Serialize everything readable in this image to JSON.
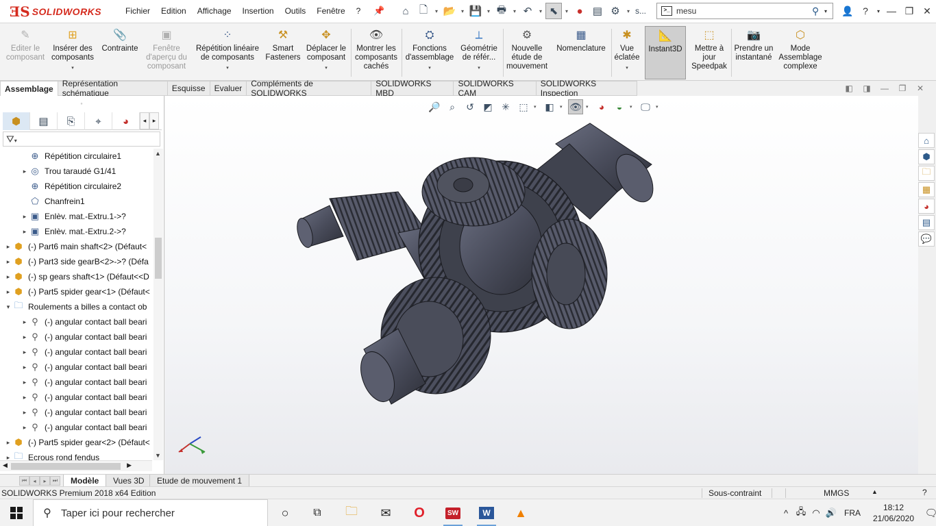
{
  "app": {
    "logo_text": "SOLIDWORKS",
    "menu": [
      "Fichier",
      "Edition",
      "Affichage",
      "Insertion",
      "Outils",
      "Fenêtre",
      "?"
    ],
    "search_value": "mesu",
    "search_extra": "s..."
  },
  "ribbon": [
    {
      "label": "Editer le composant",
      "icon": "edit-component-icon",
      "disabled": true
    },
    {
      "label": "Insérer des composants",
      "icon": "insert-components-icon",
      "arrow": true
    },
    {
      "label": "Contrainte",
      "icon": "mate-icon"
    },
    {
      "label": "Fenêtre d'aperçu du composant",
      "icon": "preview-window-icon",
      "disabled": true
    },
    {
      "label": "Répétition linéaire de composants",
      "icon": "linear-pattern-icon",
      "arrow": true
    },
    {
      "label": "Smart Fasteners",
      "icon": "smart-fasteners-icon"
    },
    {
      "label": "Déplacer le composant",
      "icon": "move-component-icon",
      "arrow": true
    },
    {
      "label": "Montrer les composants cachés",
      "icon": "show-hidden-icon"
    },
    {
      "label": "Fonctions d'assemblage",
      "icon": "assembly-features-icon",
      "arrow": true
    },
    {
      "label": "Géométrie de référ...",
      "icon": "reference-geometry-icon",
      "arrow": true
    },
    {
      "label": "Nouvelle étude de mouvement",
      "icon": "motion-study-icon"
    },
    {
      "label": "Nomenclature",
      "icon": "bom-icon"
    },
    {
      "label": "Vue éclatée",
      "icon": "exploded-view-icon",
      "arrow": true
    },
    {
      "label": "Instant3D",
      "icon": "instant3d-icon",
      "active": true
    },
    {
      "label": "Mettre à jour Speedpak",
      "icon": "speedpak-icon"
    },
    {
      "label": "Prendre un instantané",
      "icon": "snapshot-icon"
    },
    {
      "label": "Mode Assemblage complexe",
      "icon": "large-assembly-icon"
    }
  ],
  "cm_tabs": [
    "Assemblage",
    "Représentation schématique",
    "Esquisse",
    "Evaluer",
    "Compléments de SOLIDWORKS",
    "SOLIDWORKS MBD",
    "SOLIDWORKS CAM",
    "SOLIDWORKS Inspection"
  ],
  "tree": [
    {
      "label": "Répétition circulaire1",
      "icon": "circular-pattern-icon",
      "level": 2,
      "expander": false
    },
    {
      "label": "Trou taraudé G1/41",
      "icon": "hole-wizard-icon",
      "level": 2,
      "expander": true
    },
    {
      "label": "Répétition circulaire2",
      "icon": "circular-pattern-icon",
      "level": 2,
      "expander": false
    },
    {
      "label": "Chanfrein1",
      "icon": "chamfer-icon",
      "level": 2,
      "expander": false
    },
    {
      "label": "Enlèv. mat.-Extru.1->?",
      "icon": "cut-extrude-icon",
      "level": 2,
      "expander": true
    },
    {
      "label": "Enlèv. mat.-Extru.2->?",
      "icon": "cut-extrude-icon",
      "level": 2,
      "expander": true
    },
    {
      "label": "(-) Part6 main shaft<2> (Défaut<",
      "icon": "part-icon",
      "level": 1,
      "expander": true
    },
    {
      "label": "(-) Part3 side gearB<2>->? (Défa",
      "icon": "part-icon",
      "level": 1,
      "expander": true
    },
    {
      "label": "(-) sp gears shaft<1> (Défaut<<D",
      "icon": "part-icon",
      "level": 1,
      "expander": true
    },
    {
      "label": "(-) Part5 spider gear<1> (Défaut<",
      "icon": "part-icon",
      "level": 1,
      "expander": true
    },
    {
      "label": "Roulements a billes a contact ob",
      "icon": "folder-icon",
      "level": 1,
      "expander": true,
      "open": true
    },
    {
      "label": "(-) angular contact ball beari",
      "icon": "bearing-icon",
      "level": 2,
      "expander": true
    },
    {
      "label": "(-) angular contact ball beari",
      "icon": "bearing-icon",
      "level": 2,
      "expander": true
    },
    {
      "label": "(-) angular contact ball beari",
      "icon": "bearing-icon",
      "level": 2,
      "expander": true
    },
    {
      "label": "(-) angular contact ball beari",
      "icon": "bearing-icon",
      "level": 2,
      "expander": true
    },
    {
      "label": "(-) angular contact ball beari",
      "icon": "bearing-icon",
      "level": 2,
      "expander": true
    },
    {
      "label": "(-) angular contact ball beari",
      "icon": "bearing-icon",
      "level": 2,
      "expander": true
    },
    {
      "label": "(-) angular contact ball beari",
      "icon": "bearing-icon",
      "level": 2,
      "expander": true
    },
    {
      "label": "(-) angular contact ball beari",
      "icon": "bearing-icon",
      "level": 2,
      "expander": true
    },
    {
      "label": "(-) Part5 spider gear<2> (Défaut<",
      "icon": "part-icon",
      "level": 1,
      "expander": true
    },
    {
      "label": "Ecrous rond fendus",
      "icon": "folder-icon",
      "level": 1,
      "expander": true
    }
  ],
  "bottom_tabs": [
    "Modèle",
    "Vues 3D",
    "Etude de mouvement 1"
  ],
  "status": {
    "product": "SOLIDWORKS Premium 2018 x64 Edition",
    "state": "Sous-contraint",
    "units": "MMGS"
  },
  "taskbar": {
    "search_placeholder": "Taper ici pour rechercher",
    "language": "FRA",
    "time": "18:12",
    "date": "21/06/2020"
  },
  "colors": {
    "brand": "#d52b1e",
    "model": "#4c4f5e",
    "accent": "#2a6cc4"
  }
}
